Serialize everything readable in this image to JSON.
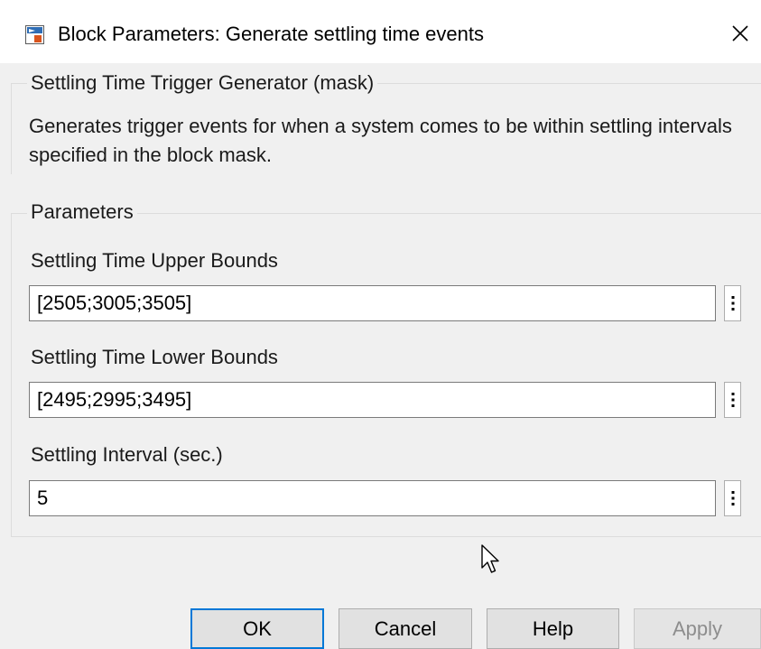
{
  "window": {
    "title": "Block Parameters: Generate settling time events",
    "app_icon": "simulink-block-icon",
    "close_icon": "close-icon"
  },
  "mask": {
    "legend": "Settling Time Trigger Generator (mask)",
    "description": "Generates trigger events for when a system comes to be within settling intervals specified in the block mask."
  },
  "parameters": {
    "legend": "Parameters",
    "fields": [
      {
        "label": "Settling Time Upper Bounds",
        "value": "[2505;3005;3505]"
      },
      {
        "label": "Settling Time Lower Bounds",
        "value": "[2495;2995;3495]"
      },
      {
        "label": "Settling Interval (sec.)",
        "value": "5"
      }
    ],
    "more_icon": "vertical-ellipsis-icon"
  },
  "buttons": {
    "ok": "OK",
    "cancel": "Cancel",
    "help": "Help",
    "apply": "Apply"
  },
  "colors": {
    "accent": "#0078d7",
    "background": "#f0f0f0",
    "disabled_text": "#8d8d8d"
  }
}
